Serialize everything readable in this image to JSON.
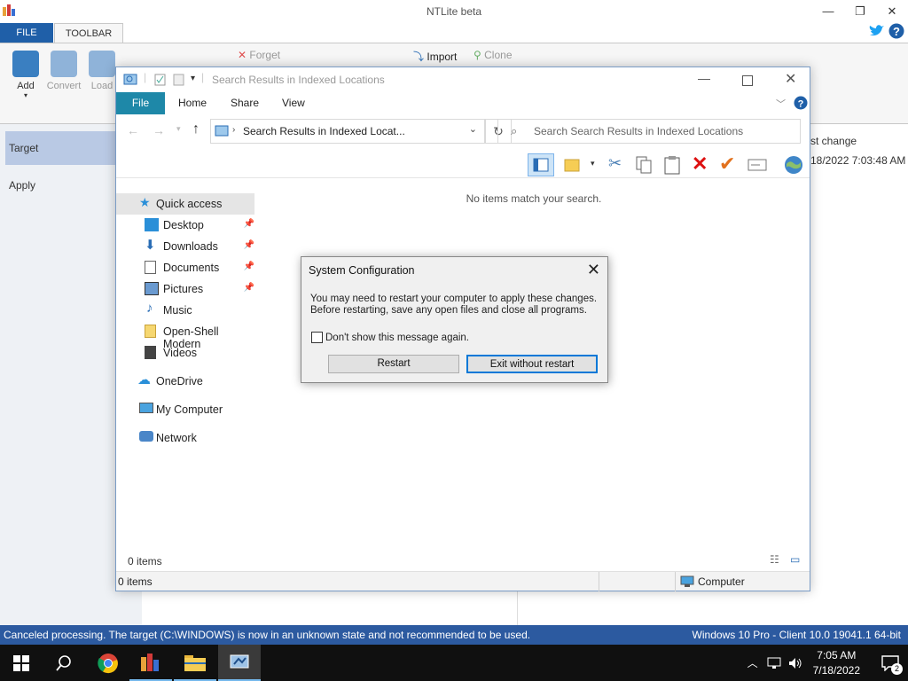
{
  "ntlite": {
    "title": "NTLite beta",
    "tabs": {
      "file": "FILE",
      "toolbar": "TOOLBAR"
    },
    "ribbon": {
      "add": "Add",
      "convert": "Convert",
      "load": "Load",
      "forget": "Forget",
      "import": "Import",
      "clone": "Clone"
    },
    "nav": {
      "target": "Target",
      "apply": "Apply"
    },
    "column_header": "st change",
    "column_value": "18/2022 7:03:48 AM",
    "status_left": "Canceled processing. The target (C:\\WINDOWS) is now in an unknown state and not recommended to be used.",
    "status_right": "Windows 10 Pro - Client 10.0 19041.1 64-bit"
  },
  "explorer": {
    "title": "Search Results in Indexed Locations",
    "tabs": {
      "file": "File",
      "home": "Home",
      "share": "Share",
      "view": "View"
    },
    "address": "Search Results in Indexed Locat...",
    "search_placeholder": "Search Search Results in Indexed Locations",
    "nav": {
      "quick_access": "Quick access",
      "desktop": "Desktop",
      "downloads": "Downloads",
      "documents": "Documents",
      "pictures": "Pictures",
      "music": "Music",
      "open_shell": "Open-Shell Modern",
      "videos": "Videos",
      "onedrive": "OneDrive",
      "my_computer": "My Computer",
      "network": "Network"
    },
    "empty_message": "No items match your search.",
    "item_count": "0 items",
    "status_count": "0 items",
    "status_location": "Computer"
  },
  "dialog": {
    "title": "System Configuration",
    "message_line1": "You may need to restart your computer to apply these changes.",
    "message_line2": "Before restarting, save any open files and close all programs.",
    "checkbox_label": "Don't show this message again.",
    "checkbox_checked": false,
    "restart_label": "Restart",
    "exit_label": "Exit without restart"
  },
  "taskbar": {
    "time": "7:05 AM",
    "date": "7/18/2022",
    "notification_count": "2"
  }
}
